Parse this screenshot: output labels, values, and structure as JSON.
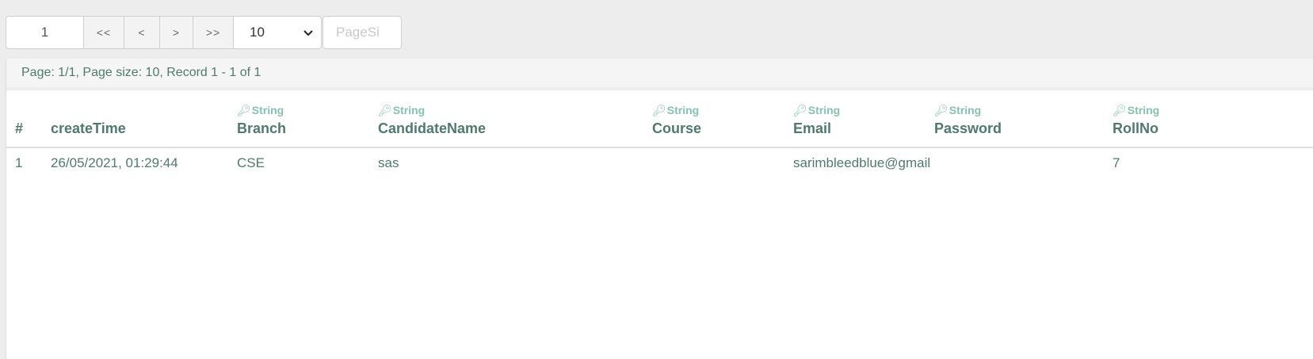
{
  "pager": {
    "page_value": "1",
    "first_label": "<<",
    "prev_label": "<",
    "next_label": ">",
    "last_label": ">>",
    "page_size_selected": "10",
    "page_size_placeholder": "PageSi"
  },
  "info": {
    "text": "Page: 1/1, Page size: 10, Record 1 - 1 of 1"
  },
  "table": {
    "type_label": "String",
    "columns": {
      "index": "#",
      "create_time": "createTime",
      "branch": "Branch",
      "candidate_name": "CandidateName",
      "course": "Course",
      "email": "Email",
      "password": "Password",
      "roll_no": "RollNo"
    },
    "rows": [
      {
        "index": "1",
        "create_time": "26/05/2021, 01:29:44",
        "branch": "CSE",
        "candidate_name": "sas",
        "course": "",
        "email": "sarimbleedblue@gmail.",
        "password": "",
        "roll_no": "7"
      }
    ]
  }
}
